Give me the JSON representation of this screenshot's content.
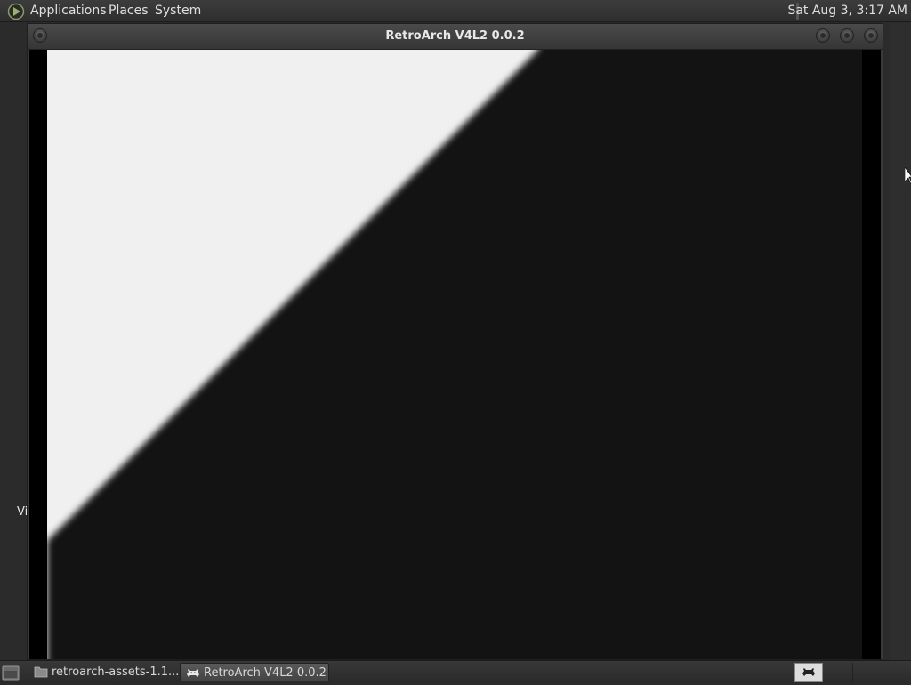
{
  "top_panel": {
    "menus": [
      "Applications",
      "Places",
      "System"
    ],
    "clock": "Sat Aug  3, 3:17 AM"
  },
  "desktop": {
    "partial_label": "Vi"
  },
  "window": {
    "title": "RetroArch V4L2 0.0.2"
  },
  "taskbar": {
    "tasks": [
      {
        "label": "retroarch-assets-1.1...",
        "icon": "folder-icon"
      },
      {
        "label": "RetroArch V4L2 0.0.2",
        "icon": "retroarch-icon",
        "active": true
      }
    ]
  },
  "colors": {
    "panel": "#333333",
    "video_light": "#f0f0f0",
    "video_dark": "#131313"
  }
}
